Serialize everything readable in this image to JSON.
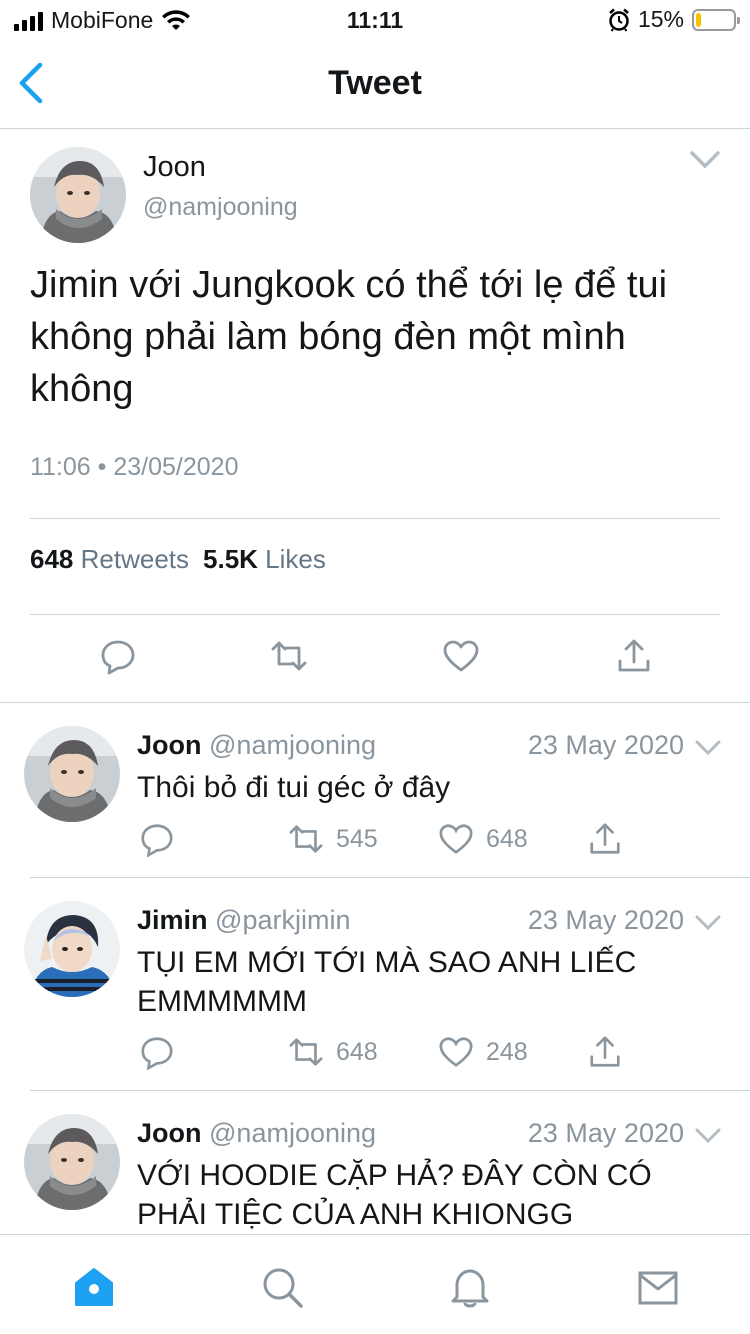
{
  "status_bar": {
    "carrier": "MobiFone",
    "time": "11:11",
    "battery": "15%",
    "battery_level": 0.15,
    "icons": [
      "signal-icon",
      "wifi-icon",
      "alarm-icon",
      "battery-icon"
    ]
  },
  "nav": {
    "title": "Tweet",
    "back_icon": "chevron-left-icon"
  },
  "main_tweet": {
    "name": "Joon",
    "handle": "@namjooning",
    "text": "Jimin với Jungkook có thể tới lẹ để tui không phải làm bóng đèn một mình không",
    "timestamp": "11:06 • 23/05/2020",
    "retweets_count": "648",
    "retweets_label": "Retweets",
    "likes_count": "5.5K",
    "likes_label": "Likes",
    "actions": [
      "reply-icon",
      "retweet-icon",
      "like-icon",
      "share-icon"
    ]
  },
  "replies": [
    {
      "name": "Joon",
      "handle": "@namjooning",
      "date": "23 May 2020",
      "text": "Thôi bỏ đi tui géc ở đây",
      "retweets": "545",
      "likes": "648"
    },
    {
      "name": "Jimin",
      "handle": "@parkjimin",
      "date": "23 May 2020",
      "text": "TỤI EM MỚI TỚI MÀ SAO ANH LIẾC EMMMMMM",
      "retweets": "648",
      "likes": "248"
    },
    {
      "name": "Joon",
      "handle": "@namjooning",
      "date": "23 May 2020",
      "text": "VỚI HOODIE CẶP HẢ? ĐÂY CÒN CÓ PHẢI TIỆC CỦA ANH KHIONGG"
    }
  ],
  "tab_bar": {
    "tabs": [
      "home-icon",
      "search-icon",
      "notifications-icon",
      "messages-icon"
    ],
    "active": "home-icon"
  },
  "colors": {
    "accent": "#1da1f2",
    "muted": "#8a959e",
    "divider": "#ccd6dd"
  }
}
